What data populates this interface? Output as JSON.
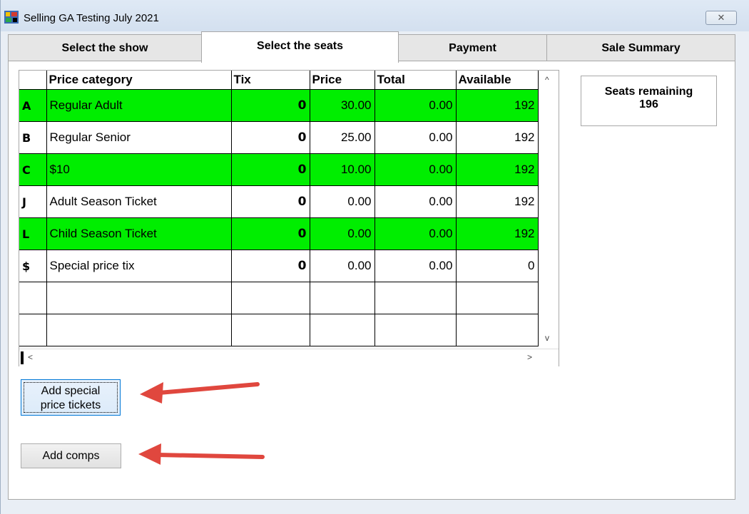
{
  "window": {
    "title": "Selling GA Testing July 2021",
    "close_glyph": "✕"
  },
  "tabs": [
    {
      "label": "Select the show"
    },
    {
      "label": "Select the seats"
    },
    {
      "label": "Payment"
    },
    {
      "label": "Sale Summary"
    }
  ],
  "grid": {
    "headers": [
      "Price category",
      "Tix",
      "Price",
      "Total",
      "Available"
    ],
    "rows": [
      {
        "code": "A",
        "category": "Regular Adult",
        "tix": "0",
        "price": "30.00",
        "total": "0.00",
        "available": "192",
        "highlight": true
      },
      {
        "code": "B",
        "category": "Regular Senior",
        "tix": "0",
        "price": "25.00",
        "total": "0.00",
        "available": "192",
        "highlight": false
      },
      {
        "code": "C",
        "category": "$10",
        "tix": "0",
        "price": "10.00",
        "total": "0.00",
        "available": "192",
        "highlight": true
      },
      {
        "code": "J",
        "category": "Adult Season Ticket",
        "tix": "0",
        "price": "0.00",
        "total": "0.00",
        "available": "192",
        "highlight": false
      },
      {
        "code": "L",
        "category": "Child Season Ticket",
        "tix": "0",
        "price": "0.00",
        "total": "0.00",
        "available": "192",
        "highlight": true
      },
      {
        "code": "$",
        "category": "Special price tix",
        "tix": "0",
        "price": "0.00",
        "total": "0.00",
        "available": "0",
        "highlight": false
      }
    ],
    "empty_rows": 2,
    "scroll_up": "^",
    "scroll_down": "v",
    "scroll_left": "<",
    "scroll_right": ">"
  },
  "seats": {
    "label": "Seats remaining",
    "value": "196"
  },
  "buttons": {
    "special_line1": "Add special",
    "special_line2": "price tickets",
    "comps": "Add comps"
  },
  "colors": {
    "highlight": "#00ee00",
    "annotation_arrow": "#e0473e",
    "focus": "#0078d7"
  }
}
